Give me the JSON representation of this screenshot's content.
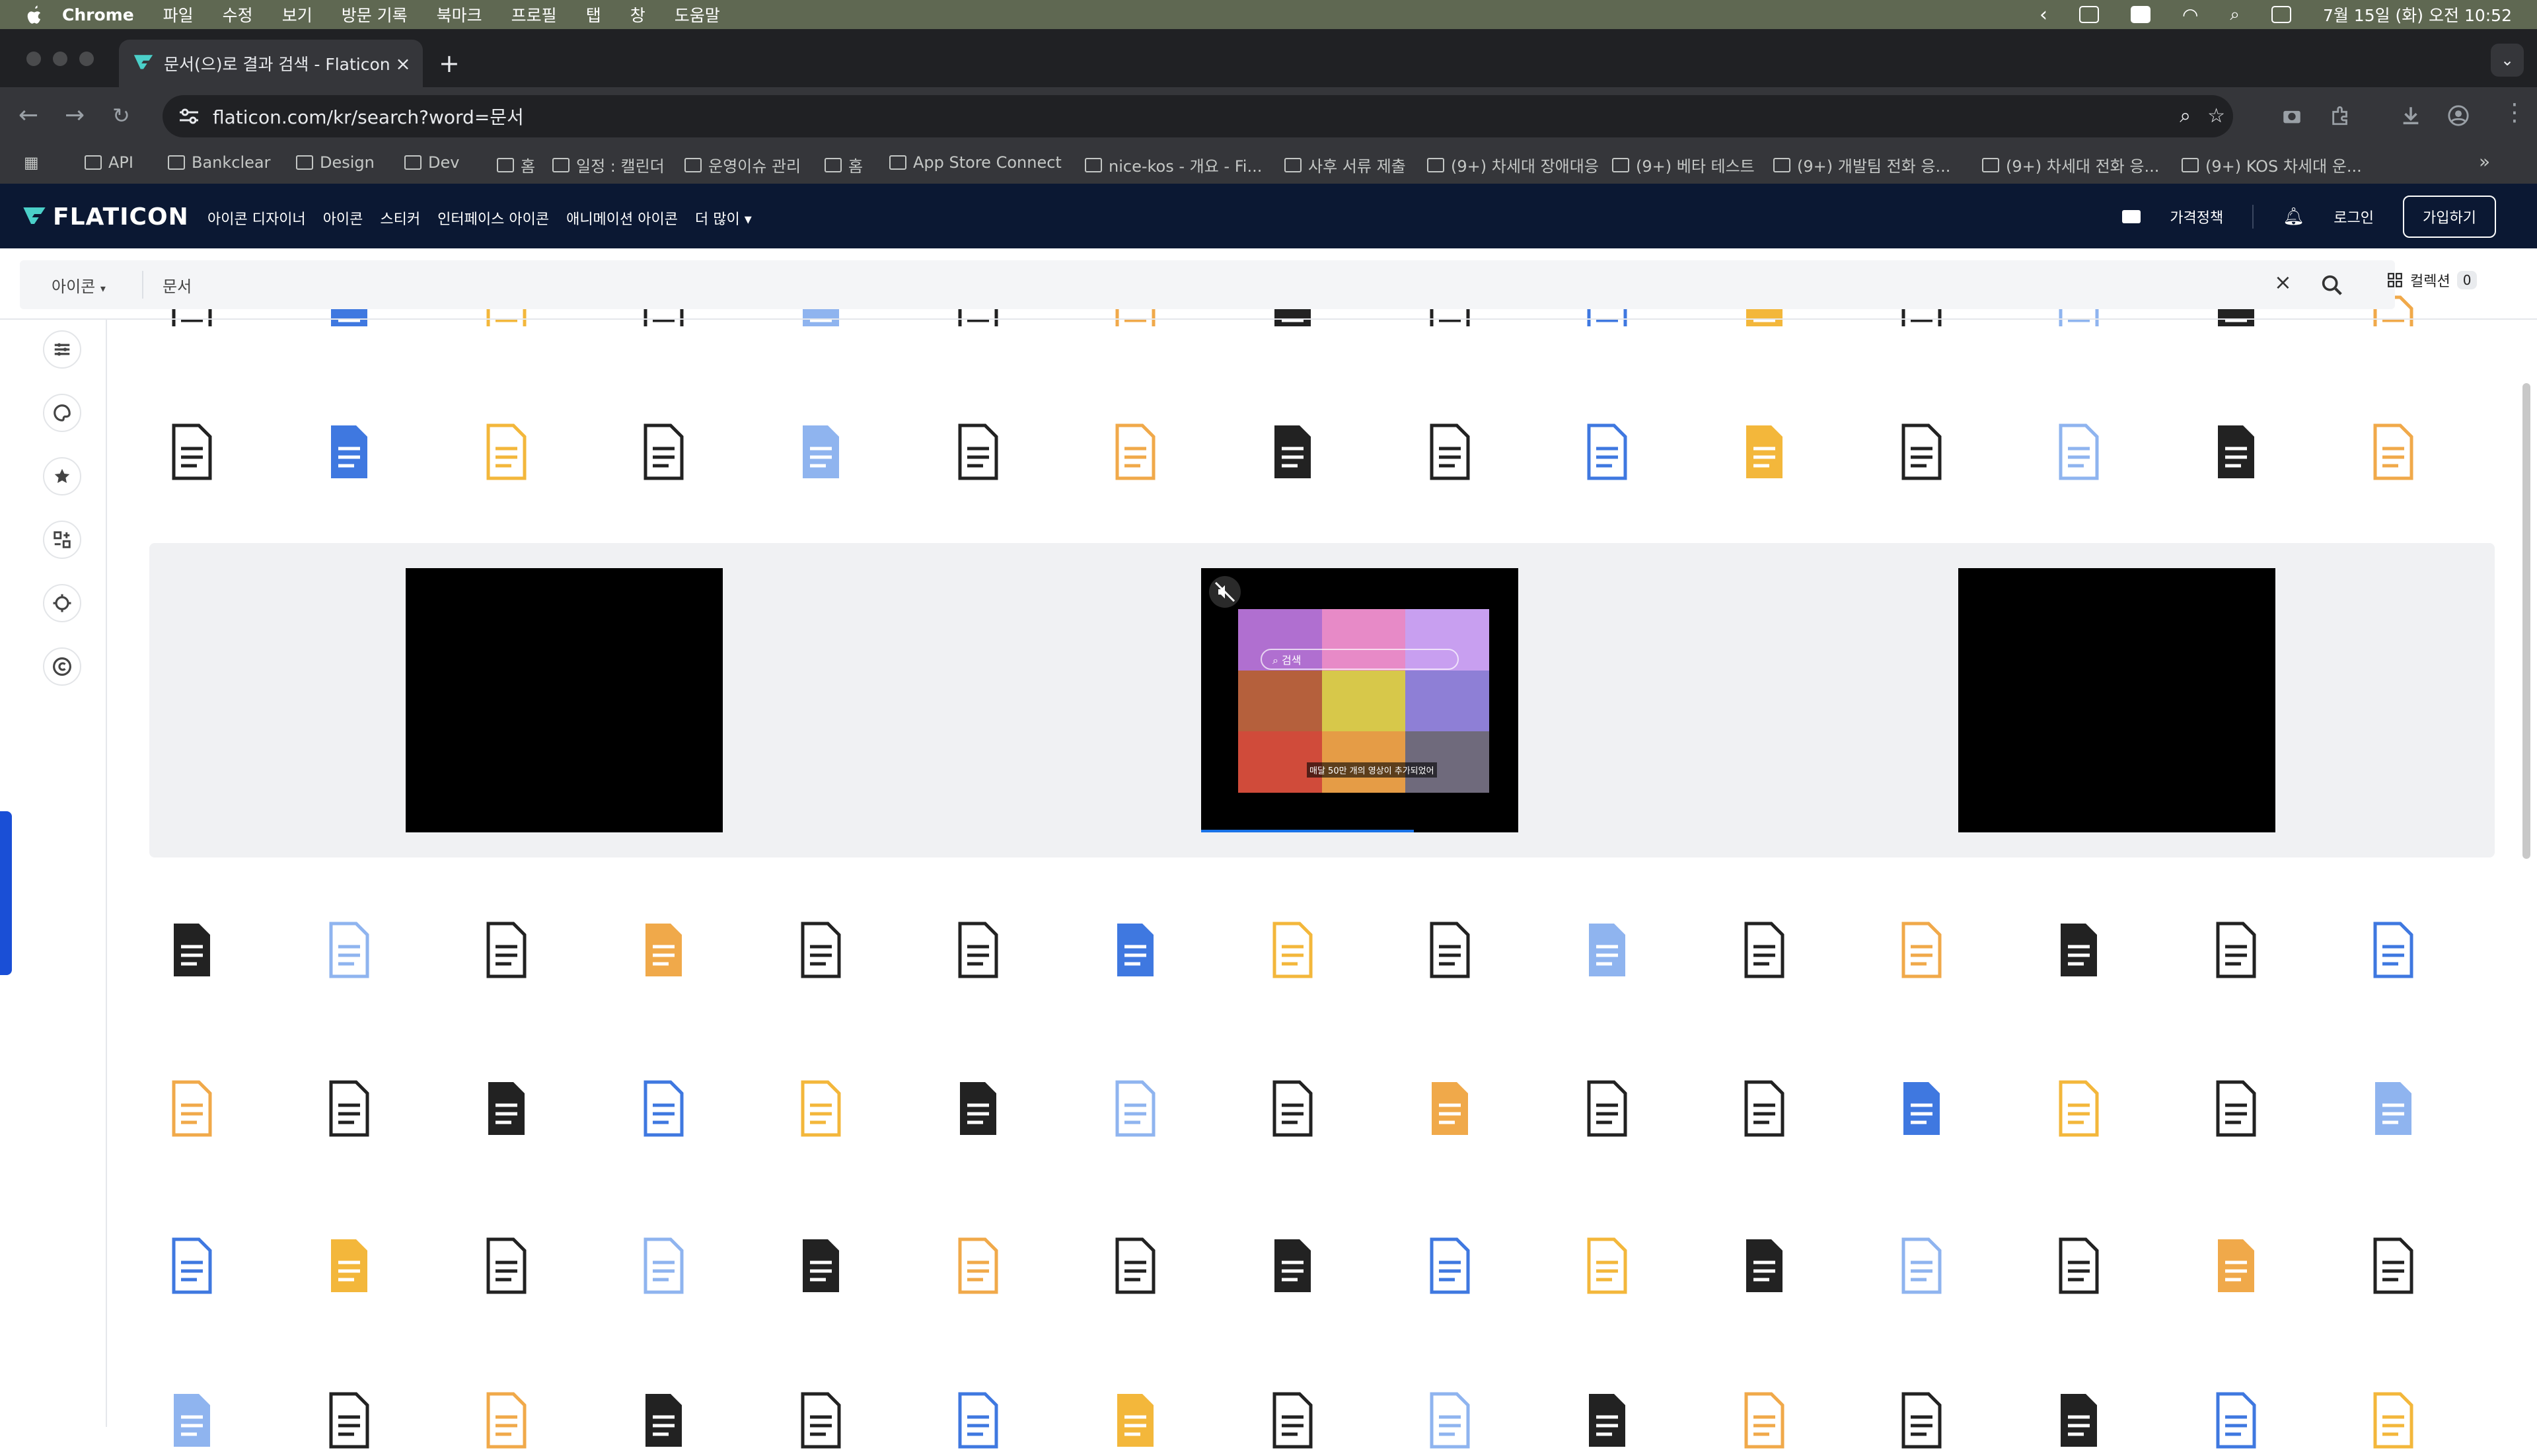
{
  "os_menu": {
    "items": [
      "Chrome",
      "파일",
      "수정",
      "보기",
      "방문 기록",
      "북마크",
      "프로필",
      "탭",
      "창",
      "도움말"
    ],
    "clock": "7월 15일 (화) 오전 10:52"
  },
  "browser": {
    "tab_title": "문서(으)로 결과 검색 - Flaticon",
    "url": "flaticon.com/kr/search?word=문서",
    "bookmarks": [
      "API",
      "Bankclear",
      "Design",
      "Dev",
      "홈",
      "일정 : 캘린더",
      "운영이슈 관리",
      "홈",
      "App Store Connect",
      "nice-kos - 개요 - Fi...",
      "사후 서류 제출",
      "(9+) 차세대 장애대응",
      "(9+) 베타 테스트",
      "(9+) 개발팀 전화 응...",
      "(9+) 차세대 전화 응...",
      "(9+) KOS 차세대 운..."
    ]
  },
  "site": {
    "logo": "FLATICON",
    "nav": [
      "아이콘 디자이너",
      "아이콘",
      "스티커",
      "인터페이스 아이콘",
      "애니메이션 아이콘",
      "더 많이"
    ],
    "pricing": "가격정책",
    "login": "로그인",
    "signup": "가입하기",
    "search": {
      "type": "아이콘",
      "query": "문서"
    },
    "collections_label": "컬렉션",
    "collections_count": "0",
    "ad_video": {
      "search_text": "검색",
      "caption": "매달 50만 개의 영상이 추가되었어"
    }
  },
  "icon_rows": [
    {
      "names": [
        "check-document-icon",
        "blank-page-icon",
        "stacked-papers-icon",
        "orange-clipboard-icon",
        "yellow-checklist-icon",
        "doc-check-icon",
        "checklist-pen-icon",
        "lined-document-icon",
        "text-document-icon",
        "approved-form-icon",
        "light-blue-doc-icon",
        "blue-google-doc-icon",
        "stacked-documents-icon",
        "yellow-note-icon",
        "check-document-2-icon"
      ]
    },
    {
      "names": [
        "blue-doc-icon",
        "magnifier-doc-icon",
        "edit-doc-black-icon",
        "signature-doc-icon",
        "search-doc-icon",
        "beige-files-icon",
        "inbox-tray-icon",
        "pen-notes-icon",
        "pencil-doc-icon",
        "file-drawer-icon",
        "doc-outline-icon",
        "clipboard-check-icon",
        "lined-doc-icon",
        "orange-folder-icon",
        "monitor-docs-icon"
      ]
    },
    {
      "names": [
        "yellow-folder-icon",
        "archive-box-icon",
        "open-folder-icon",
        "doc-settings-icon",
        "workflow-icon",
        "blue-files-icon",
        "computer-doc-icon",
        "computer-edit-icon",
        "form-pen-icon",
        "doc-zoom-icon",
        "black-folder-icon",
        "pale-doc-icon",
        "grey-doc-icon",
        "copy-doc-icon",
        "paper-stack-icon"
      ]
    },
    {
      "names": [
        "secure-doc-icon",
        "doc-review-icon",
        "clipboard-list-icon",
        "note-icon",
        "google-doc-icon",
        "gray-pages-icon",
        "yellow-search-icon",
        "overlap-docs-icon",
        "plain-doc-icon",
        "doc-magnify-icon",
        "black-doc-icon",
        "edit-page-icon",
        "simple-doc-icon",
        "sign-form-icon",
        "light-doc-icon"
      ]
    },
    {
      "names": [
        "receipt-icon",
        "gray-stack-icon",
        "doc-search-icon",
        "orange-page-icon",
        "clipboard-icon",
        "doc-pen-icon",
        "find-doc-icon",
        "files-icon",
        "folder-yellow-icon",
        "chart-doc-icon",
        "report-icon",
        "pencil-lines-icon",
        "document-icon",
        "clipboard-checklist-icon",
        "light-blue-page-icon"
      ]
    }
  ],
  "colors": {
    "header_bg": "#0b1833",
    "logo_accent": "#4bd0c9",
    "ad_bg": "#f0f1f3",
    "doc_blue": "#3f78e0",
    "doc_yellow": "#f3b73b",
    "check_green": "#43a047"
  }
}
